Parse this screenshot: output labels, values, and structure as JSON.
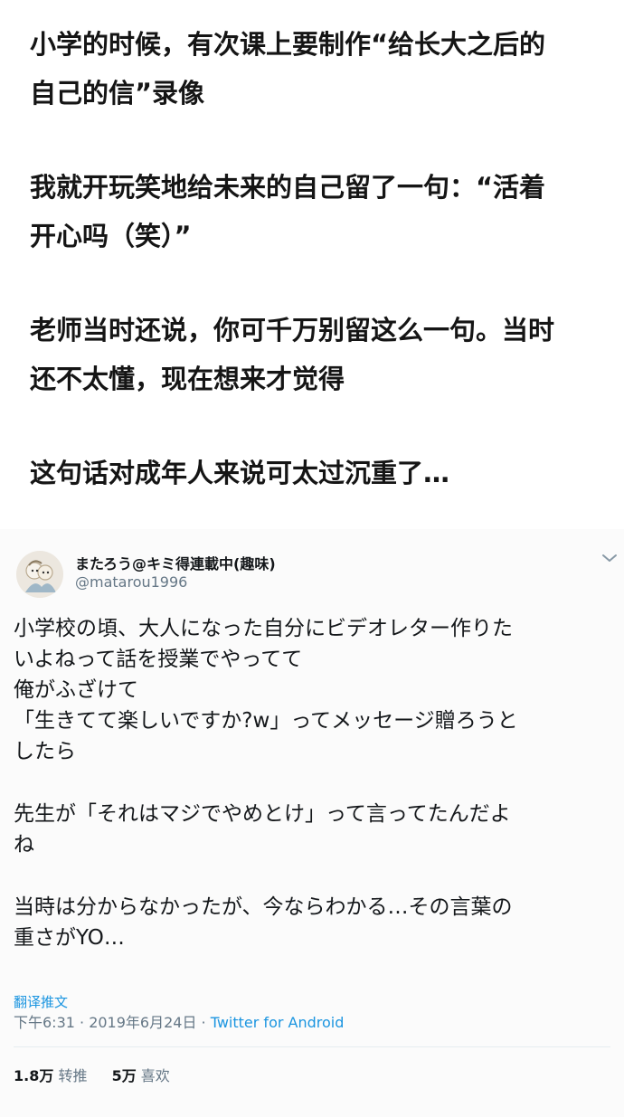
{
  "intro": {
    "paragraphs": [
      "小学的时候，有次课上要制作“给长大之后的\n自己的信”录像",
      "我就开玩笑地给未来的自己留了一句：“活着\n开心吗（笑）”",
      "老师当时还说，你可千万别留这么一句。当时\n还不太懂，现在想来才觉得",
      "这句话对成年人来说可太过沉重了…"
    ]
  },
  "tweet": {
    "display_name": "またろう@キミ得連載中(趣味)",
    "handle": "@matarou1996",
    "menu_icon": "chevron-down-icon",
    "paragraphs": [
      "小学校の頃、大人になった自分にビデオレター作りた\nいよねって話を授業でやってて\n俺がふざけて\n「生きてて楽しいですか?w」ってメッセージ贈ろうと\nしたら",
      "先生が「それはマジでやめとけ」って言ってたんだよ\nね",
      "当時は分からなかったが、今ならわかる…その言葉の\n重さがYO…"
    ],
    "translate_label": "翻译推文",
    "timestamp": "下午6:31 · 2019年6月24日 · ",
    "source": "Twitter for Android",
    "retweets": {
      "count": "1.8万",
      "label": "转推"
    },
    "likes": {
      "count": "5万",
      "label": "喜欢"
    }
  },
  "colors": {
    "link": "#1b95e0",
    "secondary_text": "#657786",
    "primary_text": "#14171a"
  }
}
